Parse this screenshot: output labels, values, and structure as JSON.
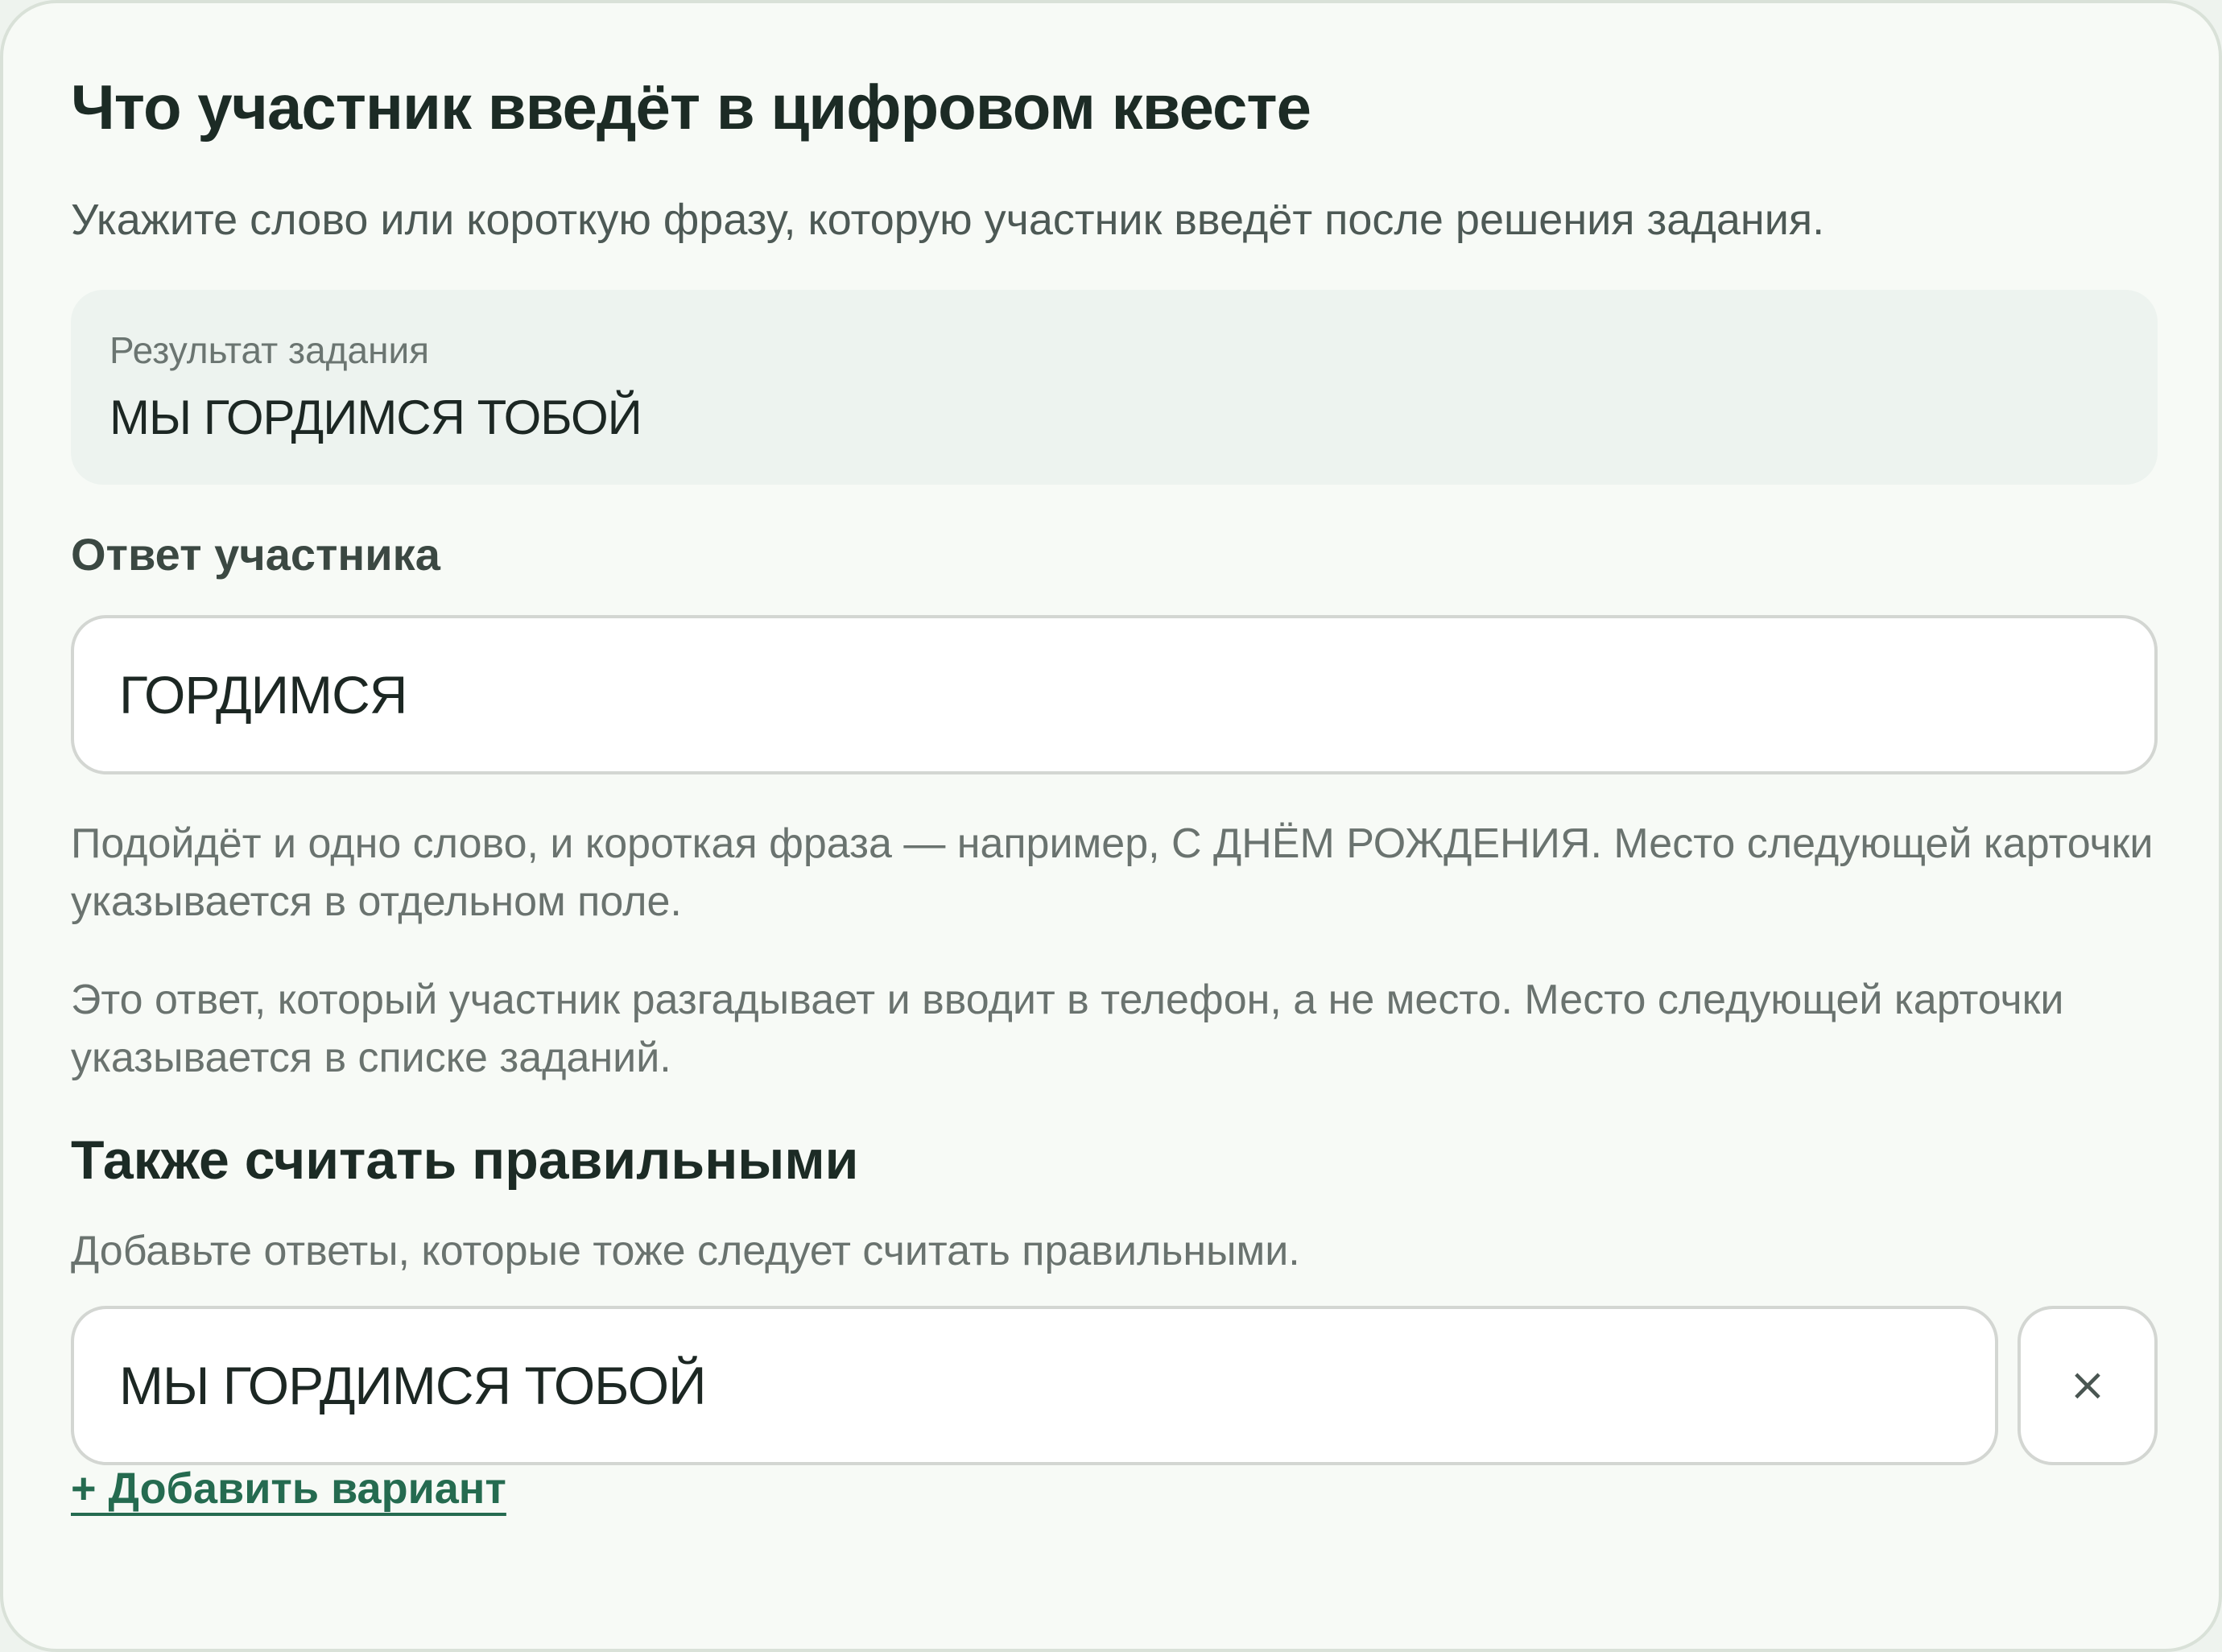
{
  "header": {
    "title": "Что участник введёт в цифровом квесте",
    "subtitle": "Укажите слово или короткую фразу, которую участник введёт после решения задания."
  },
  "result": {
    "label": "Результат задания",
    "value": "МЫ ГОРДИМСЯ ТОБОЙ"
  },
  "answer": {
    "label": "Ответ участника",
    "value": "ГОРДИМСЯ",
    "hint": "Подойдёт и одно слово, и короткая фраза — например, С ДНЁМ РОЖДЕНИЯ. Место следующей карточки указывается в отдельном поле.",
    "note": "Это ответ, который участник разгадывает и вводит в телефон, а не место. Место следующей карточки указывается в списке заданий."
  },
  "alternatives": {
    "heading": "Также считать правильными",
    "description": "Добавьте ответы, которые тоже следует считать правильными.",
    "items": [
      {
        "value": "МЫ ГОРДИМСЯ ТОБОЙ",
        "remove_label": "×"
      }
    ],
    "add_label": "+ Добавить вариант"
  },
  "colors": {
    "card_background": "#f7faf6",
    "result_background": "#edf3ef",
    "accent_link": "#256b50",
    "text_primary": "#1c2b25",
    "text_muted": "#6a736f"
  }
}
